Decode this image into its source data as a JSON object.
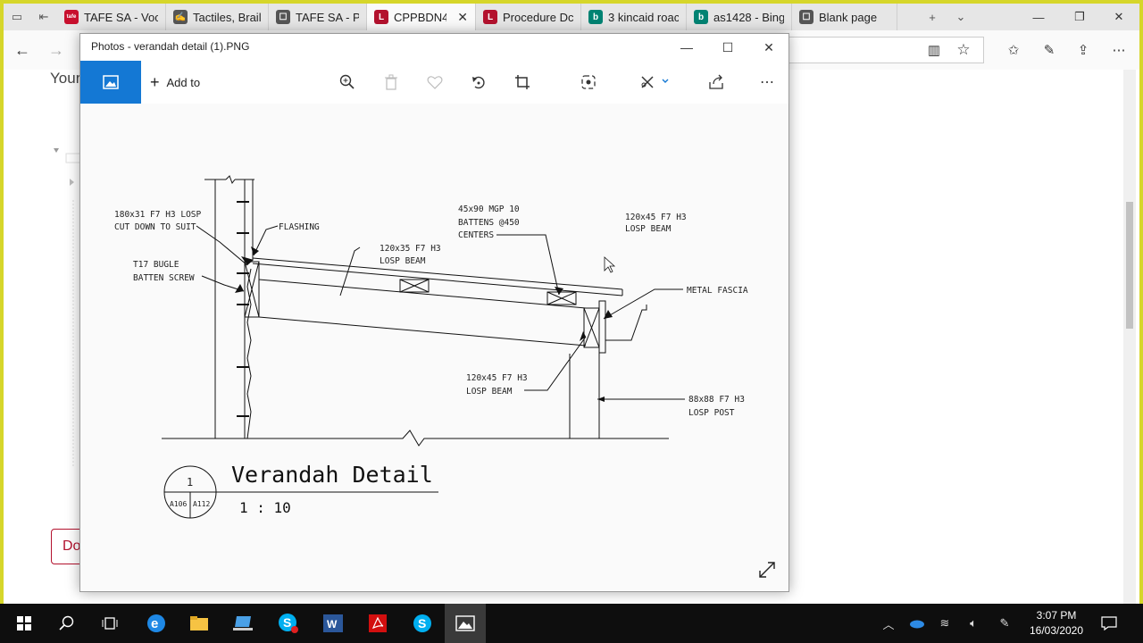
{
  "browser": {
    "tabs": [
      {
        "label": "TAFE SA - Voc",
        "favicon_color": "#c8102e",
        "favicon_text": "tafe"
      },
      {
        "label": "Tactiles, Braill",
        "favicon_color": "#555555",
        "favicon_text": "✍"
      },
      {
        "label": "TAFE SA - Por",
        "favicon_color": "#555555",
        "favicon_text": "☐"
      },
      {
        "label": "CPPBDN4",
        "favicon_color": "#b3122e",
        "favicon_text": "L",
        "active": true
      },
      {
        "label": "Procedure Dc",
        "favicon_color": "#b3122e",
        "favicon_text": "L"
      },
      {
        "label": "3 kincaid roac",
        "favicon_color": "#008373",
        "favicon_text": "b"
      },
      {
        "label": "as1428 - Bing",
        "favicon_color": "#008373",
        "favicon_text": "b"
      },
      {
        "label": "Blank page",
        "favicon_color": "#555555",
        "favicon_text": "☐"
      }
    ],
    "page_text": "Your",
    "page_button": "Do"
  },
  "photos": {
    "title": "Photos - verandah detail (1).PNG",
    "add_to": "Add to",
    "accent": "#1478d4"
  },
  "drawing": {
    "labels": {
      "l1a": "180x31 F7 H3 LOSP",
      "l1b": "CUT DOWN TO SUIT",
      "flashing": "FLASHING",
      "l3a": "45x90 MGP 10",
      "l3b": "BATTENS @450",
      "l3c": "CENTERS",
      "l4a": "120x45 F7 H3",
      "l4b": "LOSP BEAM",
      "l5a": "T17 BUGLE",
      "l5b": "BATTEN SCREW",
      "l6a": "120x35 F7 H3",
      "l6b": "LOSP BEAM",
      "fascia": "METAL FASCIA",
      "l8a": "120x45 F7 H3",
      "l8b": "LOSP BEAM",
      "l9a": "88x88 F7 H3",
      "l9b": "LOSP POST"
    },
    "title": "Verandah Detail",
    "number": "1",
    "ref_left": "A106",
    "ref_right": "A112",
    "scale": "1 : 10"
  },
  "taskbar": {
    "time": "3:07 PM",
    "date": "16/03/2020"
  }
}
